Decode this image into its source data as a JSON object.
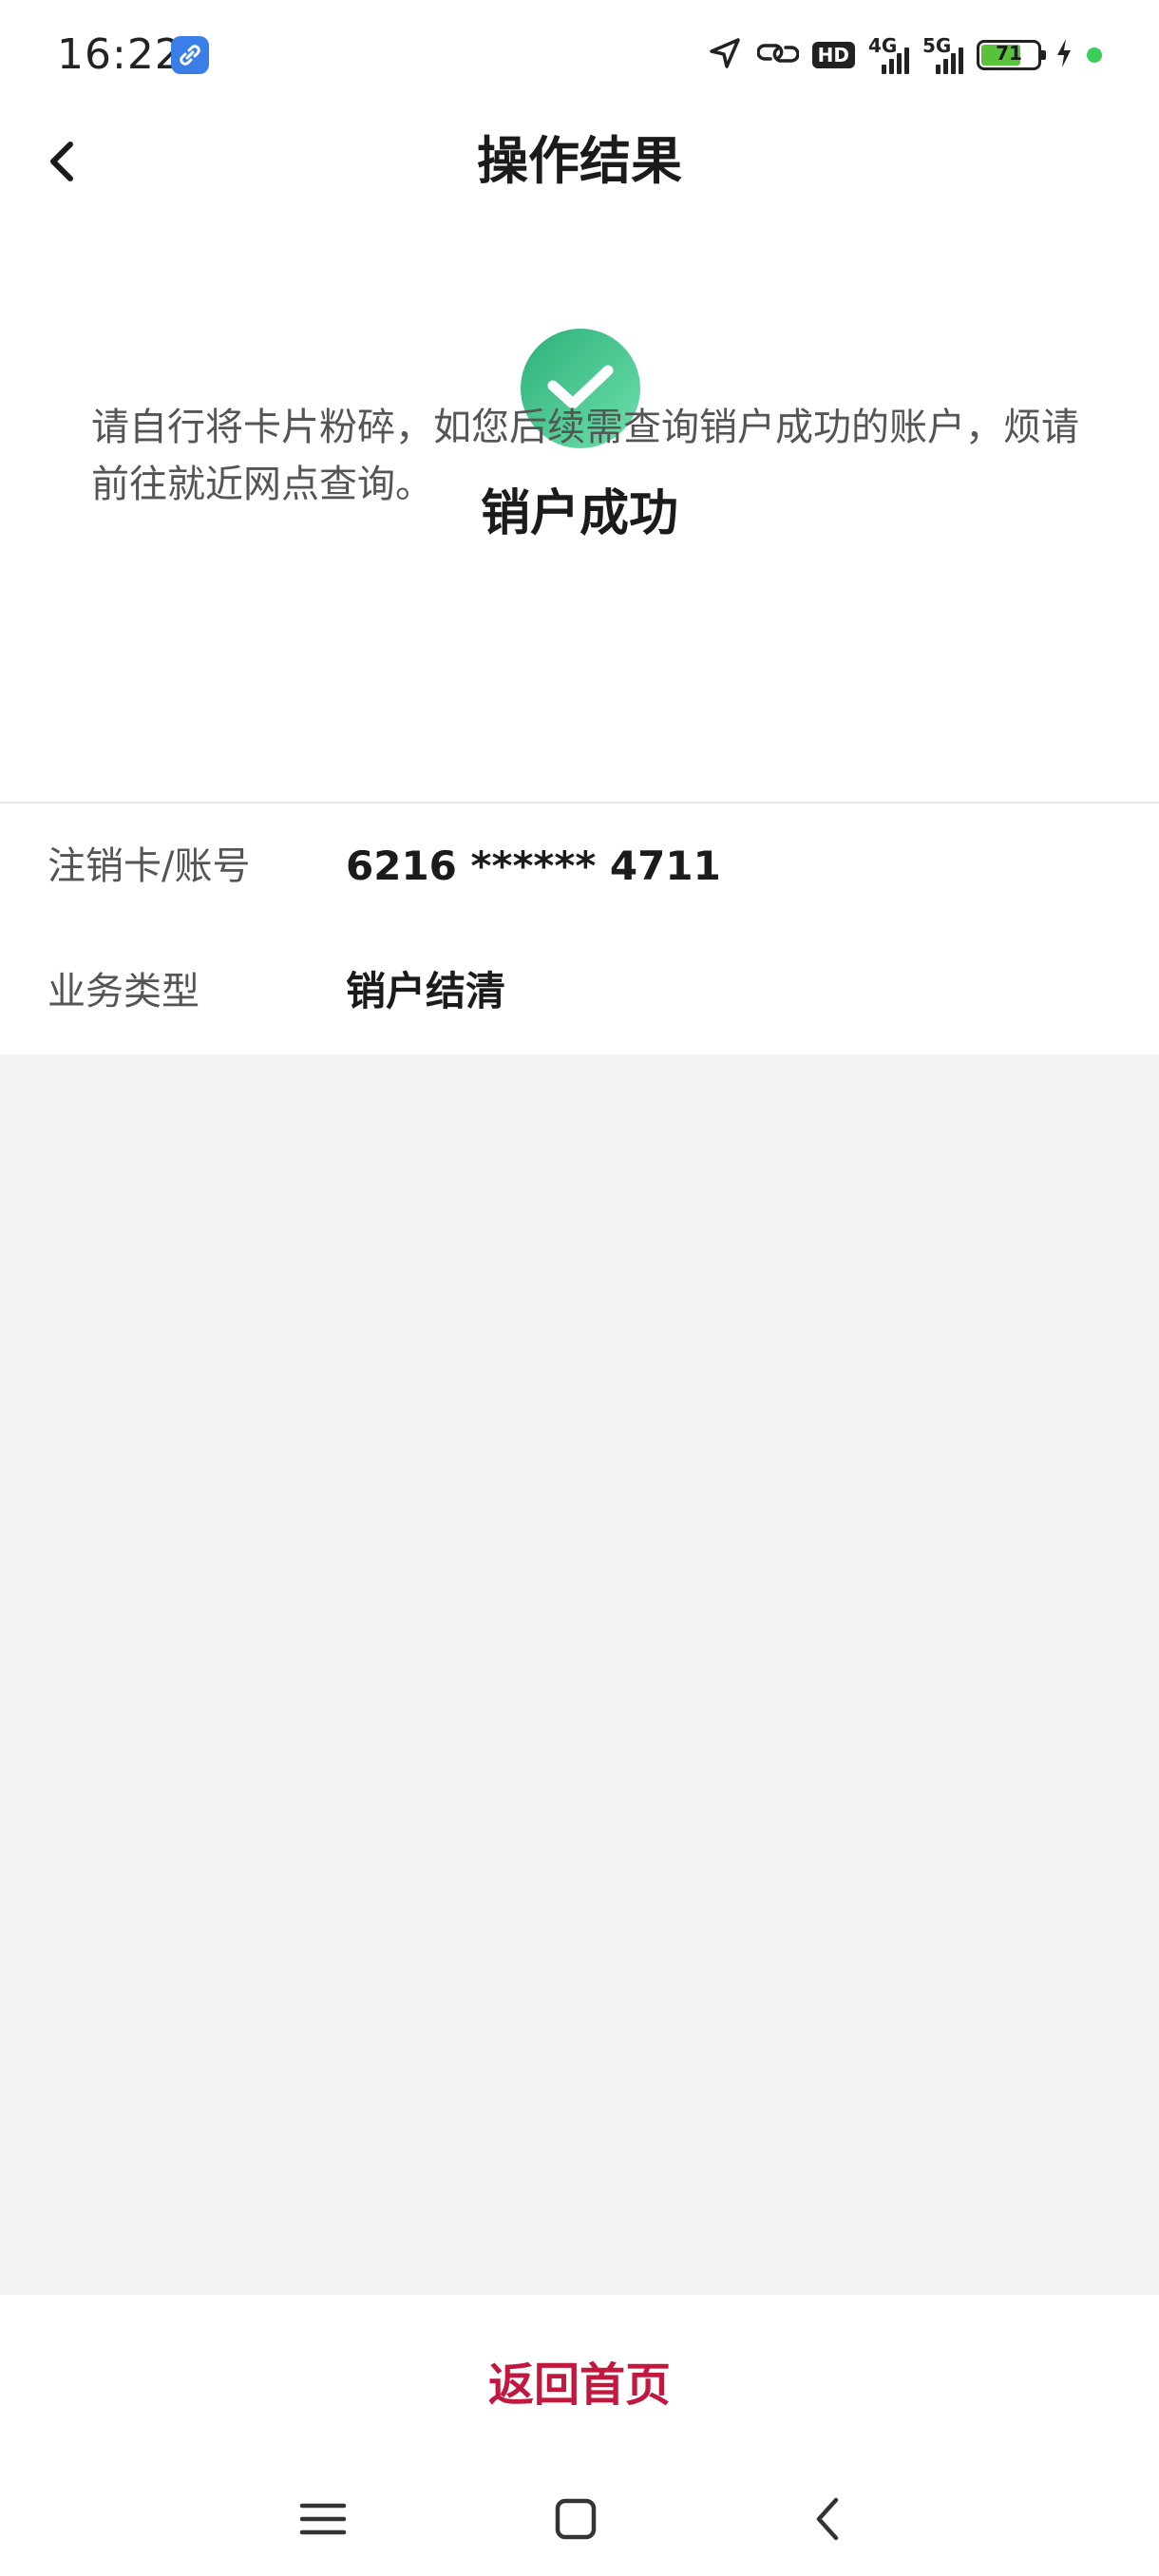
{
  "status_bar": {
    "time": "16:22",
    "hd_label": "HD",
    "network_4g": "4G",
    "network_5g": "5G",
    "battery_level": "71"
  },
  "header": {
    "title": "操作结果"
  },
  "result": {
    "title": "销户成功",
    "message": "请自行将卡片粉碎，如您后续需查询销户成功的账户，烦请前往就近网点查询。",
    "status_color": "#43c48a"
  },
  "details": [
    {
      "label": "注销卡/账号",
      "value": "6216 ****** 4711"
    },
    {
      "label": "业务类型",
      "value": "销户结清"
    }
  ],
  "footer": {
    "home_button_label": "返回首页",
    "accent_color": "#c2183f"
  },
  "icons": {
    "back": "chevron-left-icon",
    "success": "check-circle-icon",
    "nav_menu": "menu-icon",
    "nav_home": "square-icon",
    "nav_back": "chevron-left-icon"
  }
}
